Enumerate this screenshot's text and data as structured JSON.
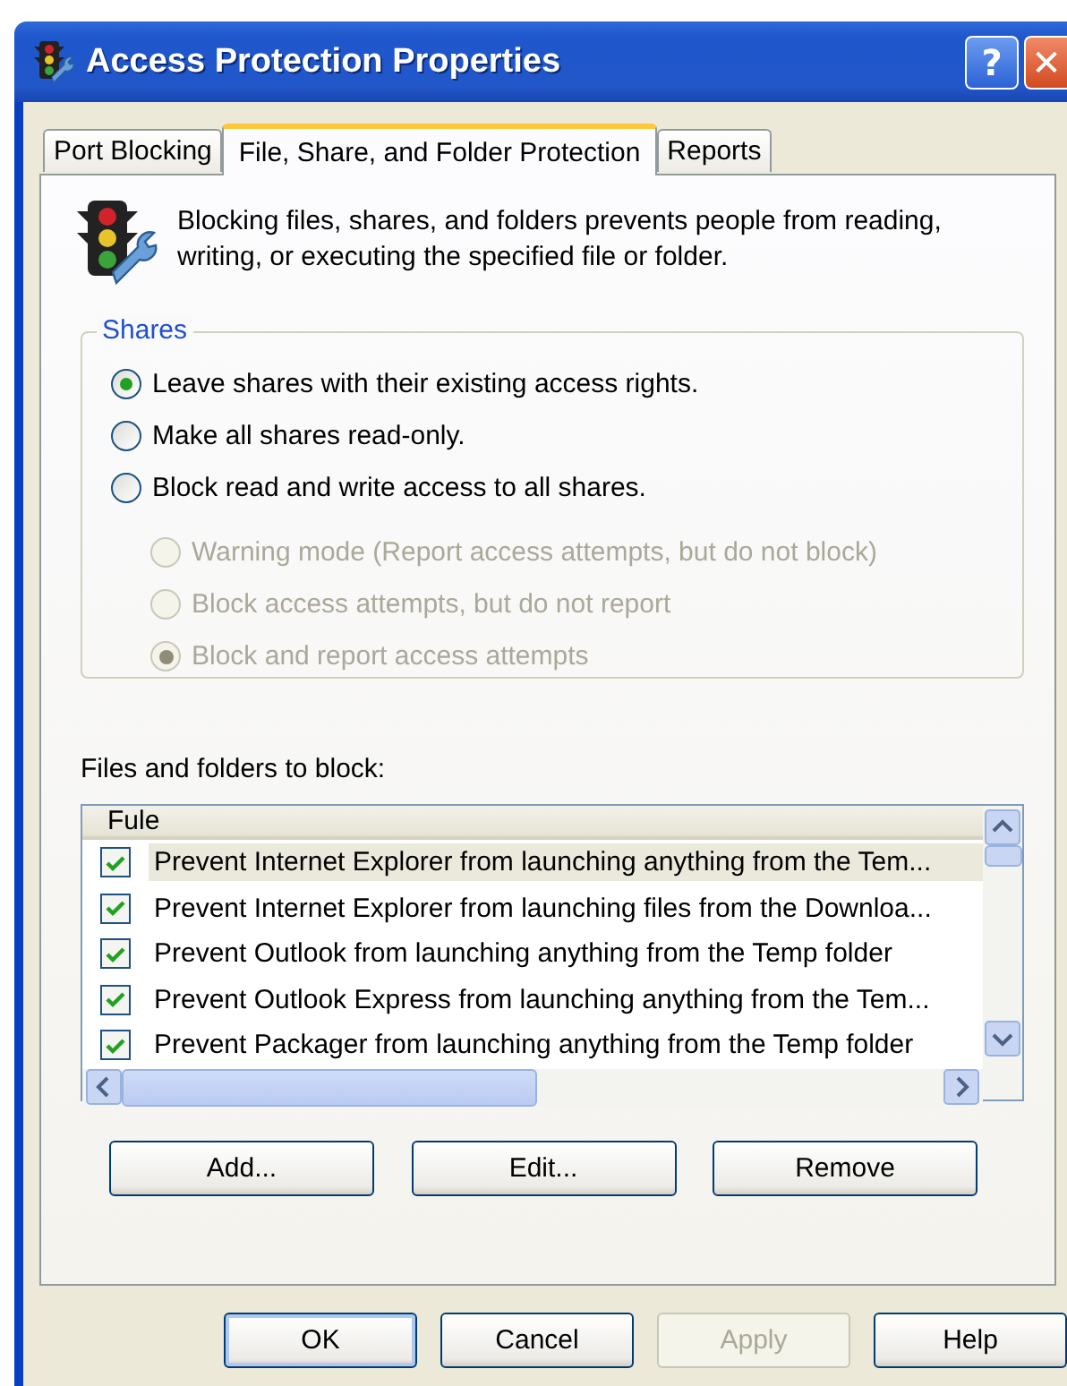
{
  "window": {
    "title": "Access Protection Properties"
  },
  "title_buttons": [
    {
      "kind": "help",
      "label": "?"
    },
    {
      "kind": "close",
      "label": "✕"
    }
  ],
  "tabs": [
    {
      "label": "Port Blocking",
      "selected": false
    },
    {
      "label": "File, Share, and Folder Protection",
      "selected": true
    },
    {
      "label": "Reports",
      "selected": false
    }
  ],
  "description": "Blocking files, shares, and folders prevents people from reading, writing, or executing the specified file or folder.",
  "shares": {
    "title": "Shares",
    "options": [
      {
        "label": "Leave shares with their existing access rights.",
        "selected": true,
        "disabled": false
      },
      {
        "label": "Make all shares read-only.",
        "selected": false,
        "disabled": false
      },
      {
        "label": "Block read and write access to all shares.",
        "selected": false,
        "disabled": false,
        "children": [
          {
            "label": "Warning mode (Report access attempts, but do not block)",
            "selected": false,
            "disabled": true
          },
          {
            "label": "Block access attempts, but do not report",
            "selected": false,
            "disabled": true
          },
          {
            "label": "Block and report access attempts",
            "selected": true,
            "disabled": true
          }
        ]
      }
    ]
  },
  "files_label": "Files and folders to block:",
  "table": {
    "columns": [
      "Fule"
    ],
    "rows": [
      {
        "text": "Prevent Internet Explorer from launching anything from the Tem...",
        "checked": true,
        "selected": true
      },
      {
        "text": "Prevent Internet Explorer from launching files from the Downloa...",
        "checked": true,
        "selected": false
      },
      {
        "text": "Prevent Outlook from launching anything from the Temp folder",
        "checked": true,
        "selected": false
      },
      {
        "text": "Prevent Outlook Express from launching anything from the Tem...",
        "checked": true,
        "selected": false
      },
      {
        "text": "Prevent Packager from launching anything from the Temp folder",
        "checked": true,
        "selected": false
      }
    ]
  },
  "list_buttons": [
    {
      "label": "Add..."
    },
    {
      "label": "Edit..."
    },
    {
      "label": "Remove"
    }
  ],
  "buttons": [
    {
      "label": "OK",
      "default": true,
      "disabled": false
    },
    {
      "label": "Cancel",
      "default": false,
      "disabled": false
    },
    {
      "label": "Apply",
      "default": false,
      "disabled": true
    },
    {
      "label": "Help",
      "default": false,
      "disabled": false
    }
  ]
}
